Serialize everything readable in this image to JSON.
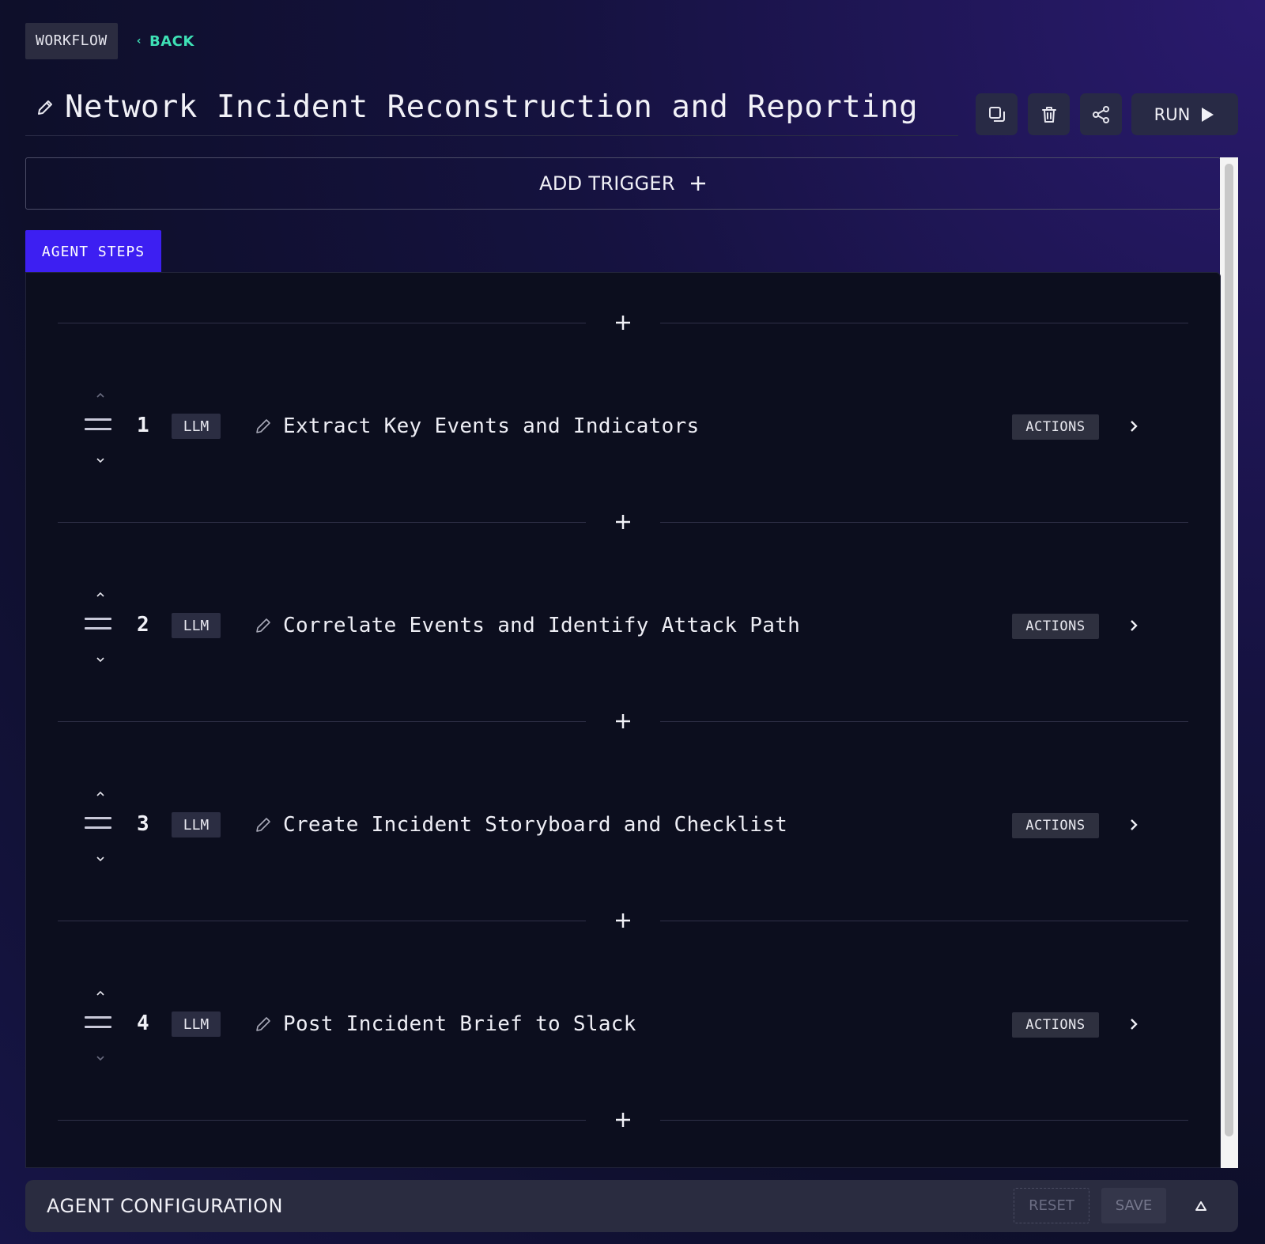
{
  "breadcrumb": {
    "section": "WORKFLOW",
    "back_label": "BACK"
  },
  "header": {
    "title": "Network Incident Reconstruction and Reporting",
    "run_label": "RUN",
    "icons": [
      "duplicate-icon",
      "trash-icon",
      "share-icon",
      "play-icon"
    ]
  },
  "trigger": {
    "label": "ADD TRIGGER"
  },
  "tabs": {
    "active": "AGENT STEPS"
  },
  "steps": [
    {
      "number": "1",
      "type": "LLM",
      "name": "Extract Key Events and Indicators",
      "actions_label": "ACTIONS"
    },
    {
      "number": "2",
      "type": "LLM",
      "name": "Correlate Events and Identify Attack Path",
      "actions_label": "ACTIONS"
    },
    {
      "number": "3",
      "type": "LLM",
      "name": "Create Incident Storyboard and Checklist",
      "actions_label": "ACTIONS"
    },
    {
      "number": "4",
      "type": "LLM",
      "name": "Post Incident Brief to Slack",
      "actions_label": "ACTIONS"
    }
  ],
  "config": {
    "label": "AGENT CONFIGURATION",
    "reset_label": "RESET",
    "save_label": "SAVE"
  },
  "colors": {
    "accent": "#3d1ff2",
    "back_link": "#3ee0b5",
    "panel_bg": "#0c0e1e"
  }
}
